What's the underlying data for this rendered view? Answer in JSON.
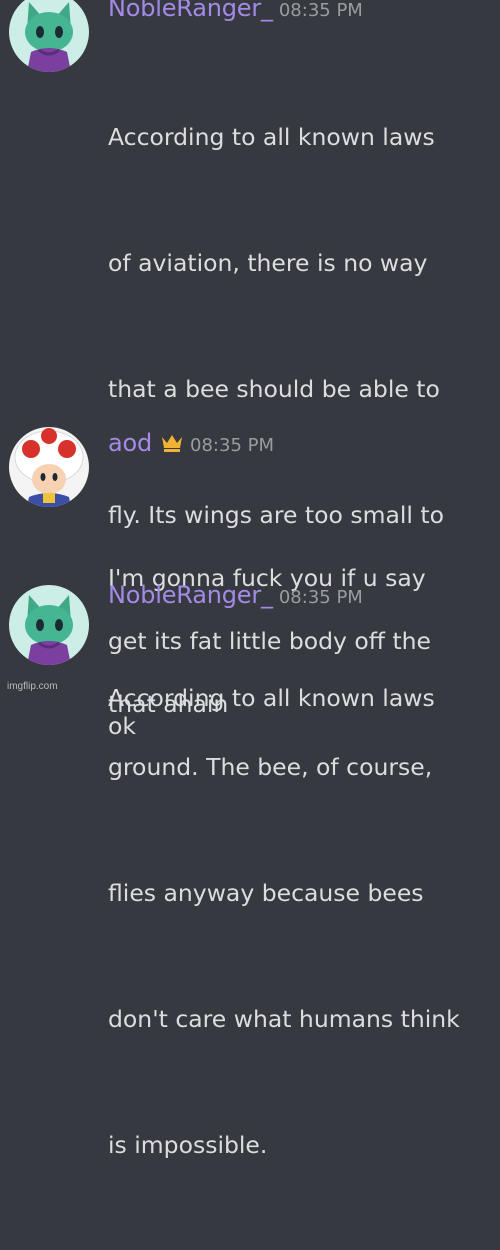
{
  "colors": {
    "background": "#36393f",
    "username_purple": "#a48ae6",
    "text": "#dcddde",
    "timestamp": "#9a9ca2",
    "crown": "#f0b232"
  },
  "messages": [
    {
      "username": "NobleRanger_",
      "timestamp": "08:35 PM",
      "avatar": "green-cat-avatar-icon",
      "lines": [
        "According to all known laws",
        "of aviation, there is no way",
        "that a bee should be able to",
        "fly. Its wings are too small to",
        "get its fat little body off the",
        "ground. The bee, of course,",
        "flies anyway because bees",
        "don't care what humans think",
        "is impossible."
      ]
    },
    {
      "username": "aod",
      "timestamp": "08:35 PM",
      "avatar": "toad-avatar-icon",
      "badge": "crown-icon",
      "lines": [
        "I'm gonna fuck you if u say",
        "that ahain"
      ]
    },
    {
      "username": "NobleRanger_",
      "timestamp": "08:35 PM",
      "avatar": "green-cat-avatar-icon",
      "lines": [
        "ok"
      ]
    }
  ],
  "partial_next_line": "According to all known laws",
  "watermark": "imgflip.com"
}
